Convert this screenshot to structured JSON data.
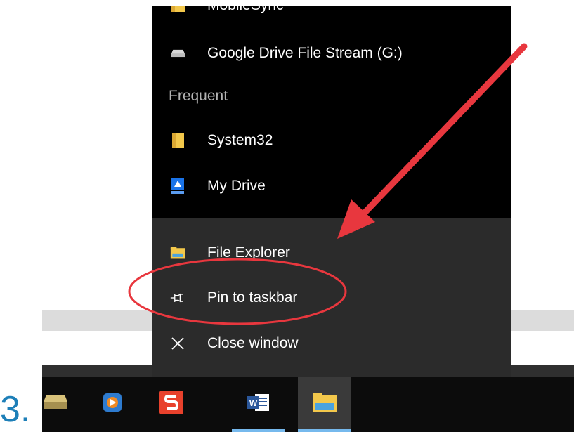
{
  "step_number": "3.",
  "jump_list": {
    "pinned_items": [
      {
        "label": "MobileSync",
        "icon": "folder-icon"
      },
      {
        "label": "Google Drive File Stream (G:)",
        "icon": "drive-icon"
      }
    ],
    "frequent_header": "Frequent",
    "frequent_items": [
      {
        "label": "System32",
        "icon": "folder-icon"
      },
      {
        "label": "My Drive",
        "icon": "google-drive-icon"
      }
    ],
    "actions": [
      {
        "label": "File Explorer",
        "icon": "file-explorer-icon"
      },
      {
        "label": "Pin to taskbar",
        "icon": "pin-icon"
      },
      {
        "label": "Close window",
        "icon": "close-icon"
      }
    ]
  },
  "taskbar": {
    "apps": [
      {
        "name": "hard-drive-app-icon"
      },
      {
        "name": "media-player-app-icon"
      },
      {
        "name": "slides-app-icon"
      },
      {
        "name": "word-app-icon",
        "label": "W"
      },
      {
        "name": "file-explorer-app-icon",
        "active": true
      }
    ]
  },
  "annotation": {
    "arrow_color": "#e8373e",
    "circle_color": "#e8373e",
    "highlighted_item": "Pin to taskbar"
  }
}
